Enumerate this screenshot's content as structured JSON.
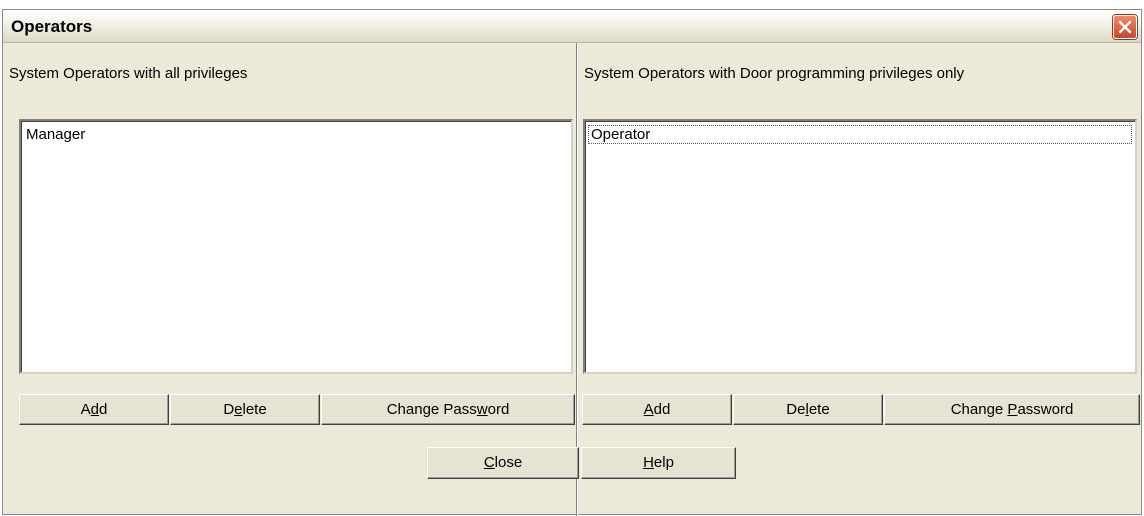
{
  "window": {
    "title": "Operators"
  },
  "left_pane": {
    "label": "System Operators with all privileges",
    "items": [
      "Manager"
    ],
    "buttons": {
      "add": {
        "pre": "A",
        "key": "d",
        "post": "d"
      },
      "delete": {
        "pre": "D",
        "key": "e",
        "post": "lete"
      },
      "change_password": {
        "pre": "Change Pass",
        "key": "w",
        "post": "ord"
      }
    }
  },
  "right_pane": {
    "label": "System Operators with Door programming privileges only",
    "items": [
      "Operator"
    ],
    "buttons": {
      "add": {
        "pre": "",
        "key": "A",
        "post": "dd"
      },
      "delete": {
        "pre": "De",
        "key": "l",
        "post": "ete"
      },
      "change_password": {
        "pre": "Change ",
        "key": "P",
        "post": "assword"
      }
    }
  },
  "footer": {
    "close": {
      "pre": "",
      "key": "C",
      "post": "lose"
    },
    "help": {
      "pre": "",
      "key": "H",
      "post": "elp"
    }
  },
  "colors": {
    "window_bg": "#ece9d8",
    "close_button": "#d6553a"
  }
}
